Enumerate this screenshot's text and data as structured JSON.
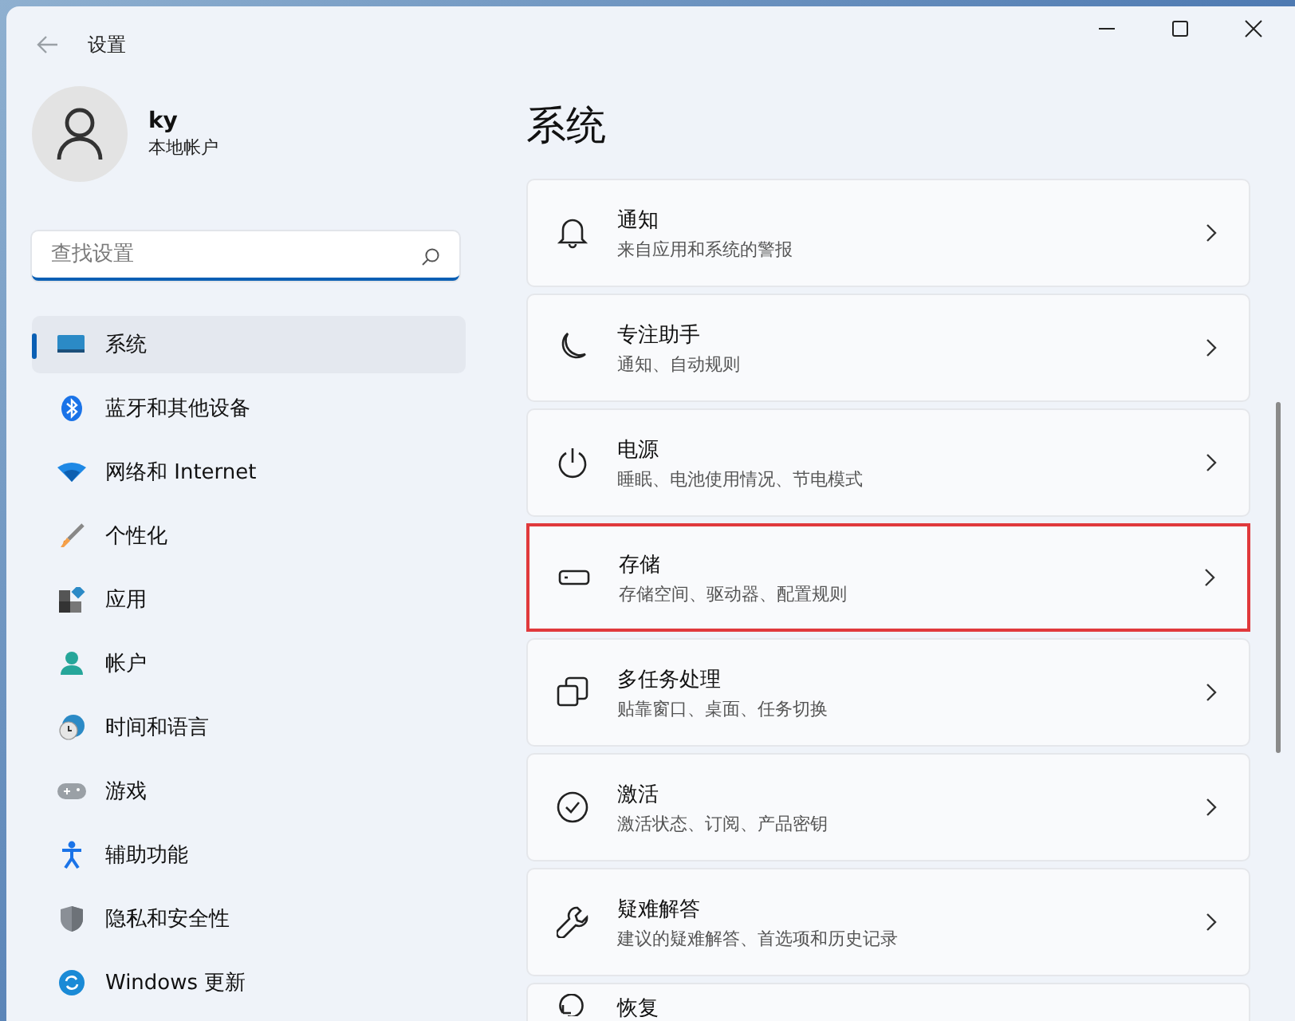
{
  "window": {
    "title": "设置"
  },
  "account": {
    "name": "ky",
    "type": "本地帐户"
  },
  "search": {
    "placeholder": "查找设置"
  },
  "sidebar": {
    "items": [
      {
        "label": "系统",
        "selected": true
      },
      {
        "label": "蓝牙和其他设备",
        "selected": false
      },
      {
        "label": "网络和 Internet",
        "selected": false
      },
      {
        "label": "个性化",
        "selected": false
      },
      {
        "label": "应用",
        "selected": false
      },
      {
        "label": "帐户",
        "selected": false
      },
      {
        "label": "时间和语言",
        "selected": false
      },
      {
        "label": "游戏",
        "selected": false
      },
      {
        "label": "辅助功能",
        "selected": false
      },
      {
        "label": "隐私和安全性",
        "selected": false
      },
      {
        "label": "Windows 更新",
        "selected": false
      }
    ]
  },
  "page": {
    "heading": "系统",
    "items": [
      {
        "title": "通知",
        "description": "来自应用和系统的警报",
        "highlighted": false
      },
      {
        "title": "专注助手",
        "description": "通知、自动规则",
        "highlighted": false
      },
      {
        "title": "电源",
        "description": "睡眠、电池使用情况、节电模式",
        "highlighted": false
      },
      {
        "title": "存储",
        "description": "存储空间、驱动器、配置规则",
        "highlighted": true
      },
      {
        "title": "多任务处理",
        "description": "贴靠窗口、桌面、任务切换",
        "highlighted": false
      },
      {
        "title": "激活",
        "description": "激活状态、订阅、产品密钥",
        "highlighted": false
      },
      {
        "title": "疑难解答",
        "description": "建议的疑难解答、首选项和历史记录",
        "highlighted": false
      },
      {
        "title": "恢复",
        "highlighted": false
      }
    ]
  }
}
